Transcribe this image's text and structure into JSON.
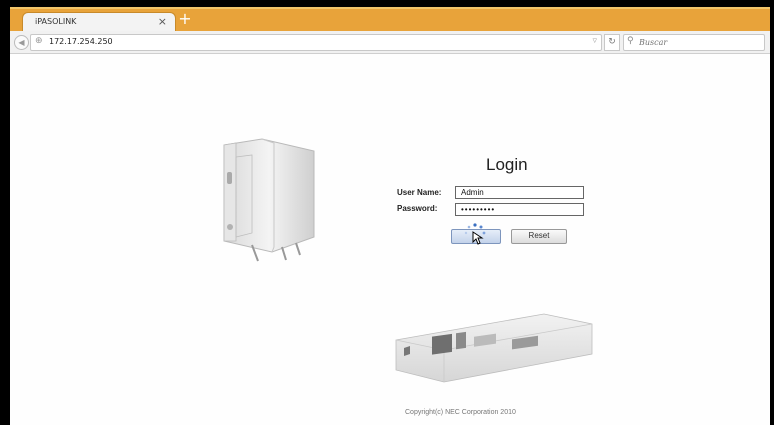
{
  "browser": {
    "tab_title": "iPASOLINK",
    "tab_close": "×",
    "new_tab": "+",
    "url": "172.17.254.250",
    "search_placeholder": "Buscar"
  },
  "login": {
    "title": "Login",
    "username_label": "User Name:",
    "username_value": "Admin",
    "password_label": "Password:",
    "password_value": "•••••••••",
    "login_button": "",
    "reset_button": "Reset"
  },
  "footer": {
    "copyright": "Copyright(c) NEC Corporation 2010"
  }
}
